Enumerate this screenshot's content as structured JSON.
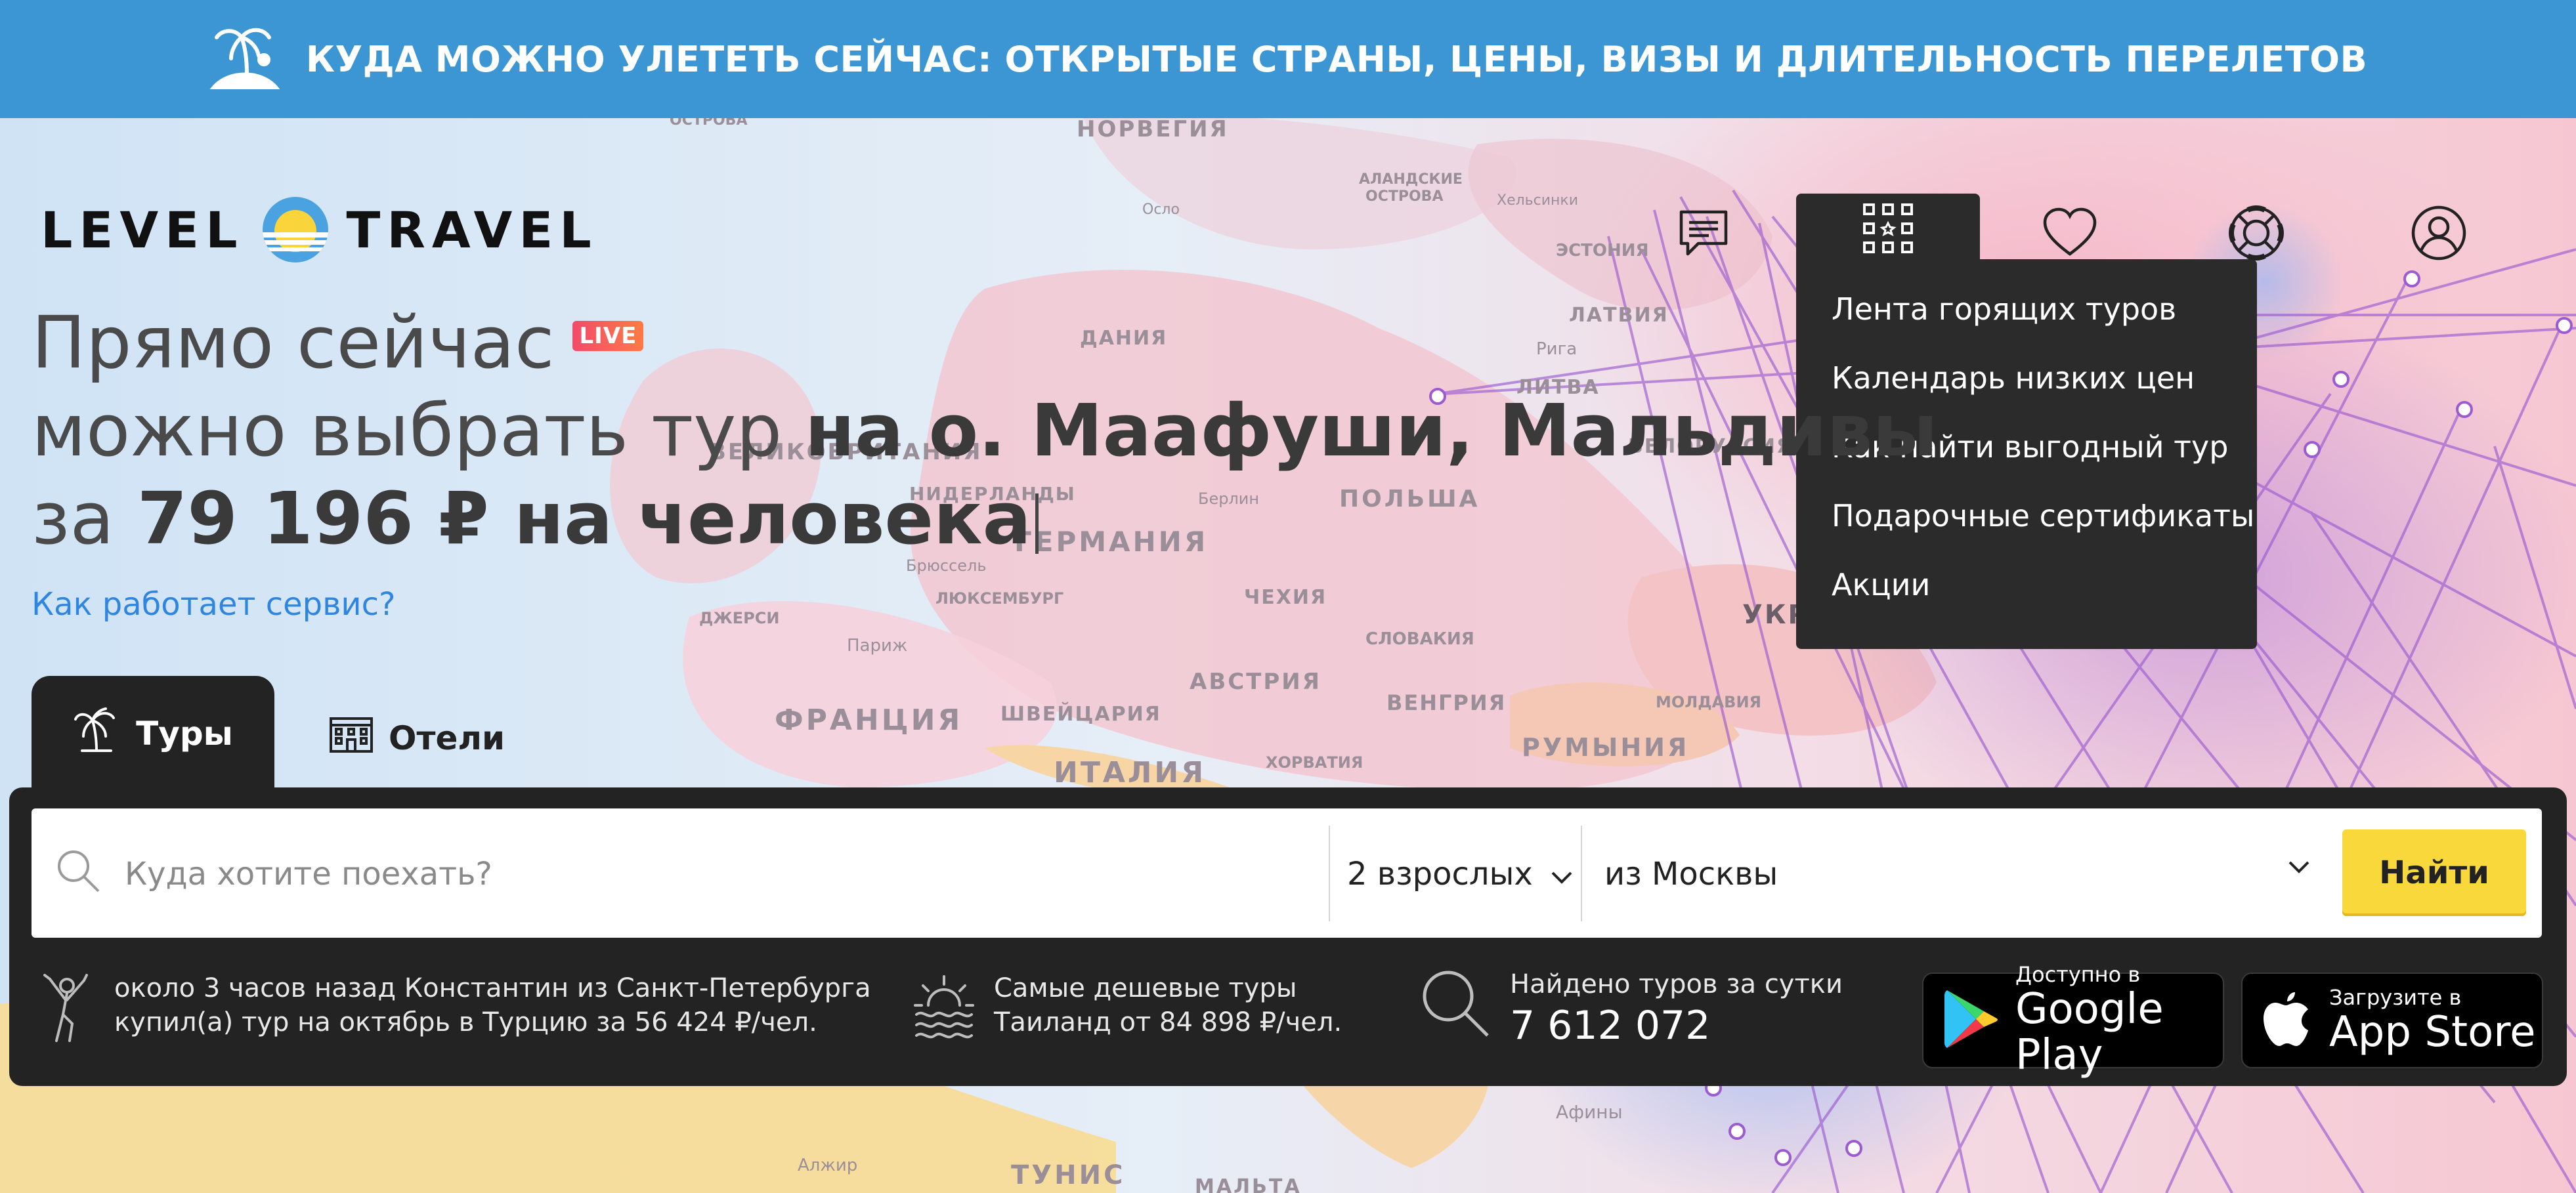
{
  "banner": {
    "icon": "palm-island-icon",
    "text": "КУДА МОЖНО УЛЕТЕТЬ СЕЙЧАС: ОТКРЫТЫЕ СТРАНЫ, ЦЕНЫ, ВИЗЫ И ДЛИТЕЛЬНОСТЬ ПЕРЕЛЕТОВ",
    "color": "#3b96d3"
  },
  "logo": {
    "left": "LEVEL",
    "right": "TRAVEL"
  },
  "header": {
    "icons": [
      "chat-icon",
      "apps-grid-icon",
      "heart-icon",
      "lifebuoy-icon",
      "user-icon"
    ],
    "menu": {
      "items": [
        "Лента горящих туров",
        "Календарь низких цен",
        "Как найти выгодный тур",
        "Подарочные сертификаты",
        "Акции"
      ]
    }
  },
  "hero": {
    "line1": "Прямо сейчас",
    "live": "LIVE",
    "line2_prefix": "можно выбрать тур ",
    "line2_bold": "на о. Маафуши, Мальдивы",
    "line3_prefix": "за ",
    "line3_bold": "79 196 ₽ на человека",
    "how_link": "Как работает сервис?"
  },
  "tabs": {
    "tours": "Туры",
    "hotels": "Отели"
  },
  "search": {
    "placeholder": "Куда хотите поехать?",
    "guests": "2 взрослых",
    "from": "из Москвы",
    "button": "Найти"
  },
  "info": {
    "recent_line1": "около 3 часов назад Константин из Санкт-Петербурга",
    "recent_line2": "купил(а) тур на октябрь в Турцию за 56 424 ₽/чел.",
    "cheap_line1": "Самые дешевые туры",
    "cheap_line2": "Таиланд от 84 898 ₽/чел.",
    "found_label": "Найдено туров за сутки",
    "found_value": "7 612 072"
  },
  "stores": {
    "google_small": "Доступно в",
    "google_big": "Google Play",
    "apple_small": "Загрузите в",
    "apple_big": "App Store"
  },
  "map_labels": {
    "norway": "НОРВЕГИЯ",
    "aland": "АЛАНДСКИЕ",
    "aland2": "ОСТРОВА",
    "oslo": "Осло",
    "helsinki": "Хельсинки",
    "estonia": "ЭСТОНИЯ",
    "latvia": "ЛАТВИЯ",
    "riga": "Рига",
    "lithuania": "ЛИТВА",
    "denmark": "ДАНИЯ",
    "belarus": "БЕЛОРУССИЯ",
    "gb": "ВЕЛИКОБРИТАНИЯ",
    "netherlands": "НИДЕРЛАНДЫ",
    "berlin": "Берлин",
    "poland": "ПОЛЬША",
    "germany": "ГЕРМАНИЯ",
    "brussels": "Брюссель",
    "luxembourg": "ЛЮКСЕМБУРГ",
    "czech": "ЧЕХИЯ",
    "jersey": "ДЖЕРСИ",
    "paris": "Париж",
    "ukraine": "УКР",
    "slovakia": "СЛОВАКИЯ",
    "austria": "АВСТРИЯ",
    "france": "ФРАНЦИЯ",
    "switzerland": "ШВЕЙЦАРИЯ",
    "hungary": "ВЕНГРИЯ",
    "moldova": "МОЛДАВИЯ",
    "romania": "РУМЫНИЯ",
    "croatia": "ХОРВАТИЯ",
    "italy": "ИТАЛИЯ",
    "athens": "Афины",
    "algiers": "Алжир",
    "tunisia": "ТУНИС",
    "malta": "МАЛЬТА",
    "islands": "ОСТРОВА"
  }
}
